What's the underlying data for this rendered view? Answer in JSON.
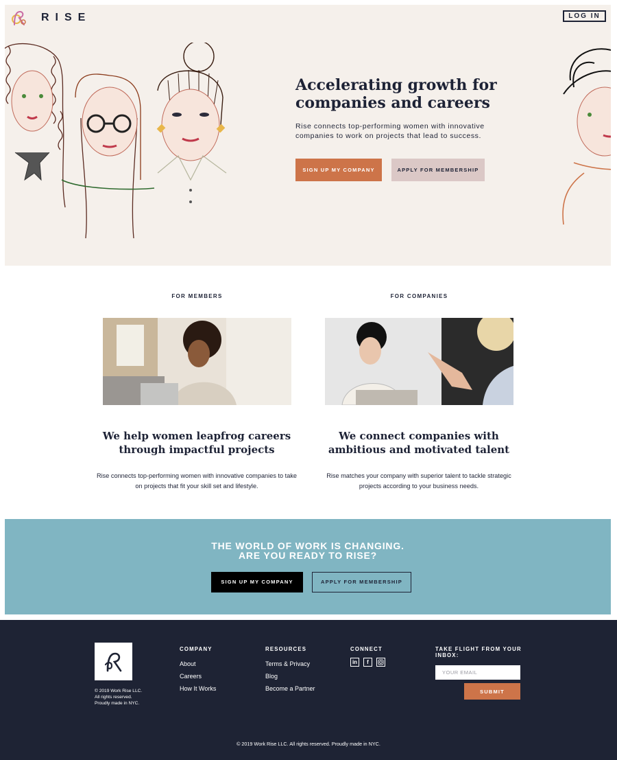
{
  "header": {
    "brand": "RISE",
    "login_label": "LOG IN"
  },
  "hero": {
    "title": "Accelerating growth for companies and careers",
    "subtitle": "Rise connects top-performing women with innovative companies to work on projects that lead to success.",
    "primary_button": "SIGN UP MY COMPANY",
    "secondary_button": "APPLY FOR MEMBERSHIP"
  },
  "features": [
    {
      "label": "FOR MEMBERS",
      "heading": "We help women leapfrog careers through impactful projects",
      "text": "Rise connects top-performing women with innovative companies to take on projects that fit your skill set and lifestyle."
    },
    {
      "label": "FOR COMPANIES",
      "heading": "We connect companies with ambitious and motivated talent",
      "text": "Rise matches your company with superior talent to tackle strategic projects according to your business needs."
    }
  ],
  "cta": {
    "title_line1": "THE WORLD OF WORK IS CHANGING.",
    "title_line2": "ARE YOU READY TO RISE?",
    "primary_button": "SIGN UP MY COMPANY",
    "secondary_button": "APPLY FOR MEMBERSHIP"
  },
  "footer": {
    "legal_line1": "© 2019 Work Rise LLC.",
    "legal_line2": "All rights reserved.",
    "legal_line3": "Proudly made in NYC.",
    "company": {
      "title": "COMPANY",
      "links": [
        "About",
        "Careers",
        "How It Works"
      ]
    },
    "resources": {
      "title": "RESOURCES",
      "links": [
        "Terms & Privacy",
        "Blog",
        "Become a Partner"
      ]
    },
    "connect": {
      "title": "CONNECT",
      "icons": [
        "linkedin-icon",
        "facebook-icon",
        "instagram-icon"
      ]
    },
    "newsletter": {
      "title": "TAKE FLIGHT FROM YOUR INBOX:",
      "placeholder": "YOUR EMAIL",
      "submit": "SUBMIT"
    },
    "copyright": "© 2019 Work Rise LLC. All rights reserved. Proudly made in NYC."
  },
  "colors": {
    "navy": "#1e2334",
    "terracotta": "#cd7449",
    "blush": "#dbc8c6",
    "cream": "#f5f0eb",
    "teal": "#80b5c2"
  }
}
